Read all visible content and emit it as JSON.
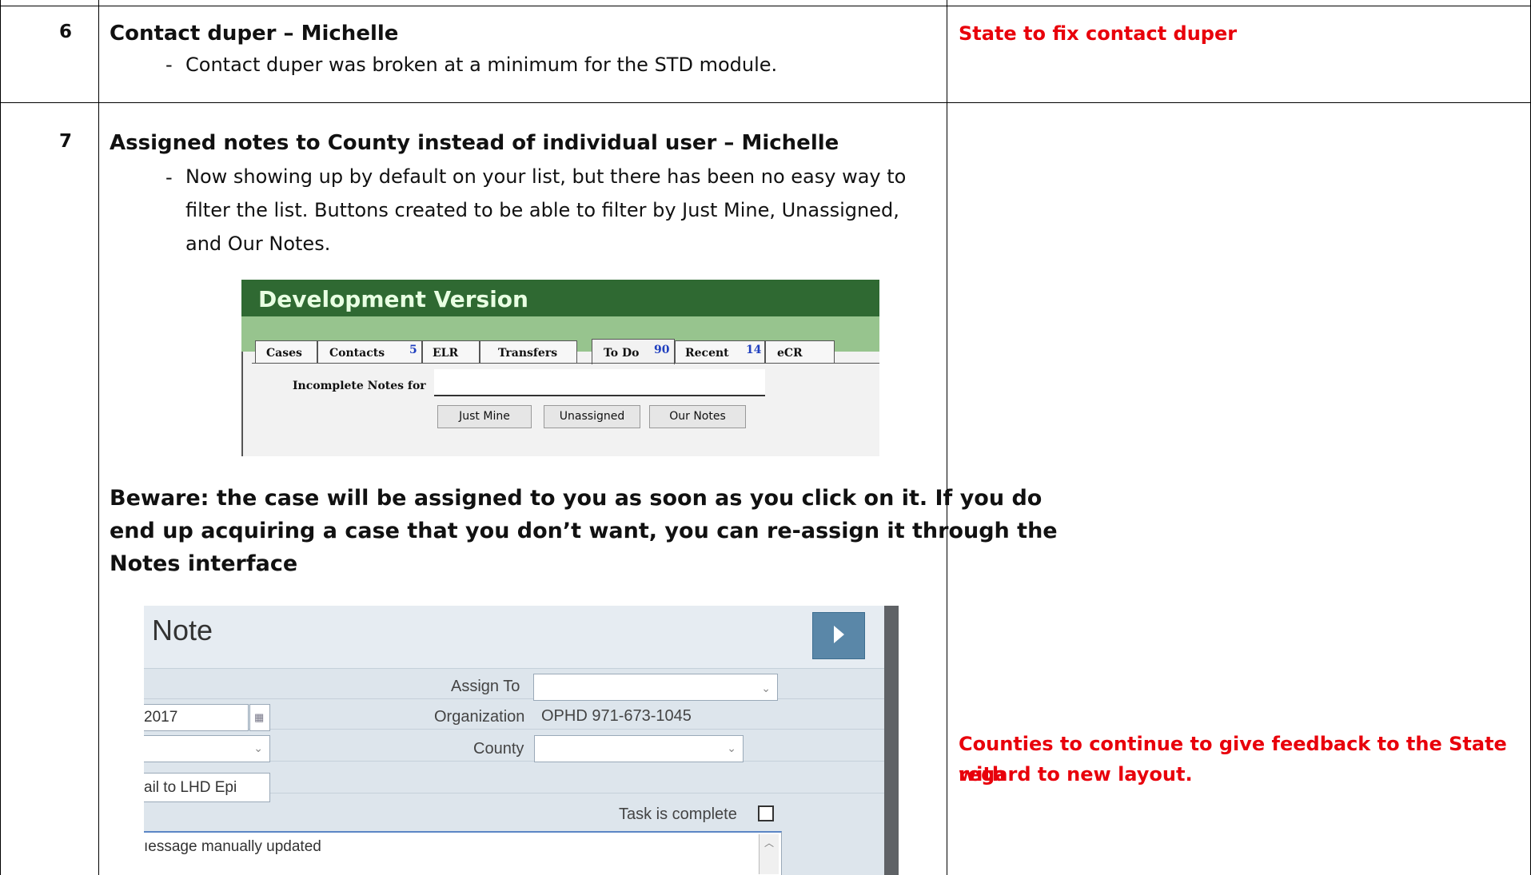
{
  "rows": [
    {
      "number": "6",
      "title": "Contact duper – Michelle",
      "bullets": [
        "Contact duper was broken at a minimum for the STD module."
      ],
      "action": "State to fix contact duper"
    },
    {
      "number": "7",
      "title": "Assigned notes to County instead of individual user – Michelle",
      "bullet_lines": [
        "Now showing up by default on your list, but there has been no easy way to",
        "filter the list. Buttons created to be able to filter by Just Mine,  Unassigned,",
        "and Our Notes."
      ],
      "beware_lines": [
        "Beware: the case will be assigned to you as soon as you click on it. If you do",
        "end up acquiring a case that you don’t want, you can re-assign it through the",
        "Notes interface"
      ],
      "action_lines": [
        "Counties to continue to give feedback to the State with",
        "regard to new layout."
      ]
    }
  ],
  "dash": "-",
  "screenshot_tabs": {
    "header": "Development Version",
    "tabs": [
      {
        "label": "Cases",
        "count": ""
      },
      {
        "label": "Contacts",
        "count": "5"
      },
      {
        "label": "ELR",
        "count": ""
      },
      {
        "label": "Transfers",
        "count": ""
      },
      {
        "label": "To Do",
        "count": "90"
      },
      {
        "label": "Recent",
        "count": "14"
      },
      {
        "label": "eCR",
        "count": ""
      }
    ],
    "active_tab": "To Do",
    "incomplete_label": "Incomplete Notes for",
    "buttons": [
      "Just Mine",
      "Unassigned",
      "Our Notes"
    ],
    "colors": {
      "header": "#2f6932",
      "band": "#97c48e",
      "count": "#1f3fbf"
    }
  },
  "screenshot_note": {
    "title": "Note",
    "date_partial": "2017",
    "email_partial": "ail to LHD Epi",
    "assign_to_label": "Assign To",
    "organization_label": "Organization",
    "organization_value": "OPHD  971-673-1045",
    "county_label": "County",
    "task_complete_label": "Task is complete",
    "message_partial": "ıessage manually updated",
    "colors": {
      "background": "#dde5ec",
      "button": "#5a87a8"
    }
  },
  "colors": {
    "action_text": "#e8000b"
  }
}
